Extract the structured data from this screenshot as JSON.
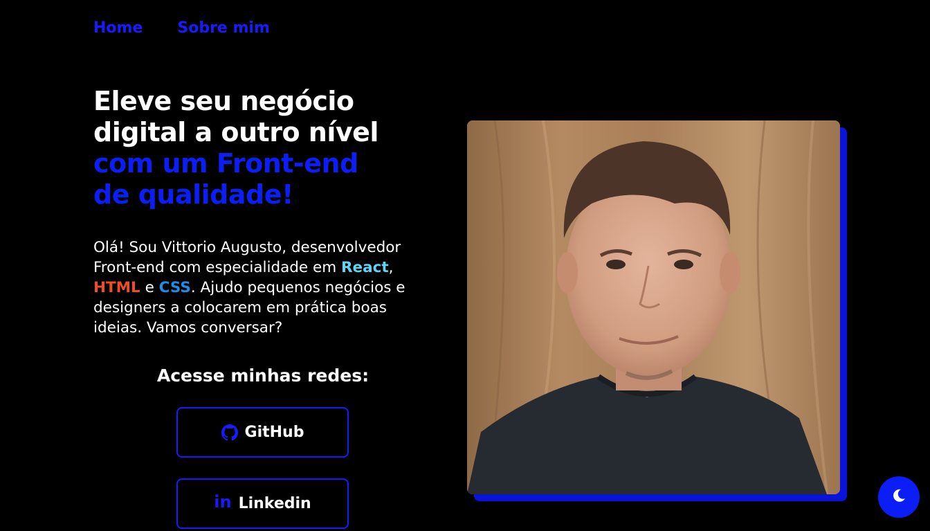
{
  "nav": {
    "home": "Home",
    "about": "Sobre mim"
  },
  "hero": {
    "line1": "Eleve seu negócio",
    "line2": "digital a outro nível",
    "line3": "com um Front-end",
    "line4": "de qualidade!"
  },
  "intro": {
    "part1": "Olá! Sou Vittorio Augusto, desenvolvedor Front-end com especialidade em ",
    "react": "React",
    "comma": ",",
    "html": "HTML",
    "and": " e ",
    "css": "CSS",
    "part2": ". Ajudo pequenos negócios e designers a colocarem em prática boas ideias. Vamos conversar?"
  },
  "socials": {
    "title": "Acesse minhas redes:",
    "github_label": "GitHub",
    "linkedin_label": "Linkedin",
    "linkedin_glyph": "in"
  },
  "icons": {
    "github": "github-icon",
    "linkedin": "linkedin-icon",
    "theme": "moon-icon"
  },
  "colors": {
    "background": "#000000",
    "accent": "#0a1ef5",
    "react": "#5ed4f4",
    "html": "#ef4d23",
    "css": "#1f8ce8"
  }
}
